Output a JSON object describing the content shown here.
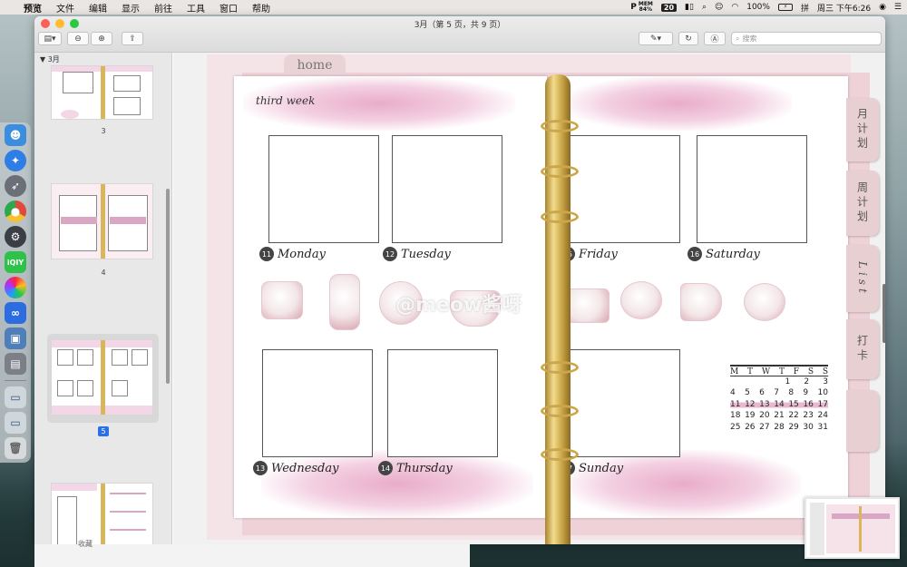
{
  "menubar": {
    "app": "预览",
    "items": [
      "文件",
      "编辑",
      "显示",
      "前往",
      "工具",
      "窗口",
      "帮助"
    ],
    "mem_label": "MEM",
    "mem_value": "84%",
    "badge": "20",
    "battery": "100%",
    "clock": "周三 下午6:26"
  },
  "window": {
    "title": "3月（第 5 页，共 9 页）",
    "search_placeholder": "搜索"
  },
  "sidebar": {
    "group": "3月",
    "pages": [
      "3",
      "4",
      "5"
    ],
    "selected_page": "5",
    "bottom_label": "收藏"
  },
  "planner": {
    "home_tab": "home",
    "week_title": "third week",
    "side_tabs": [
      "月计划",
      "周计划",
      "List",
      "打卡"
    ],
    "days": [
      {
        "num": "11",
        "name": "Monday"
      },
      {
        "num": "12",
        "name": "Tuesday"
      },
      {
        "num": "13",
        "name": "Wednesday"
      },
      {
        "num": "14",
        "name": "Thursday"
      },
      {
        "num": "15",
        "name": "Friday"
      },
      {
        "num": "16",
        "name": "Saturday"
      },
      {
        "num": "17",
        "name": "Sunday"
      }
    ],
    "watermark": "@meow酱呀",
    "calendar": {
      "header": [
        "M",
        "T",
        "W",
        "T",
        "F",
        "S",
        "S"
      ],
      "rows": [
        [
          "",
          "",
          "",
          "",
          "1",
          "2",
          "3"
        ],
        [
          "4",
          "5",
          "6",
          "7",
          "8",
          "9",
          "10"
        ],
        [
          "11",
          "12",
          "13",
          "14",
          "15",
          "16",
          "17"
        ],
        [
          "18",
          "19",
          "20",
          "21",
          "22",
          "23",
          "24"
        ],
        [
          "25",
          "26",
          "27",
          "28",
          "29",
          "30",
          "31"
        ]
      ],
      "highlight_row": 2
    }
  },
  "colors": {
    "accent": "#2a6ee8",
    "pink": "#e9b8d0",
    "gold": "#d7b65c"
  }
}
